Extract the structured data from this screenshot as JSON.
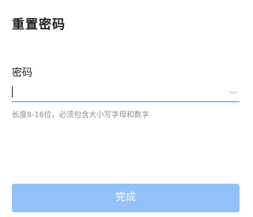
{
  "header": {
    "title": "重置密码"
  },
  "form": {
    "password_label": "密码",
    "password_value": "",
    "hint": "长度8-16位，必须包含大小写字母和数字",
    "toggle_icon": "eye-closed-icon"
  },
  "actions": {
    "done_label": "完成"
  },
  "colors": {
    "accent": "#3a8ef6",
    "button_disabled": "#92c1f9",
    "hint": "#8a8a8a"
  }
}
